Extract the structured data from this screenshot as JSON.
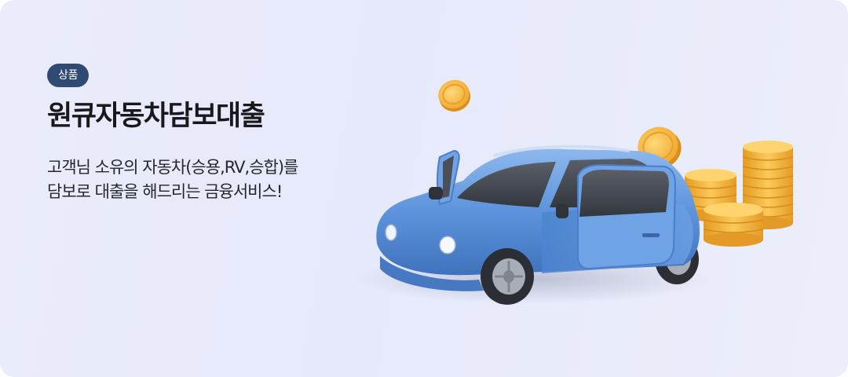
{
  "banner": {
    "badge": "상품",
    "title": "원큐자동차담보대출",
    "description_lines": [
      "고객님 소유의 자동차(승용,RV,승합)를",
      "담보로 대출을 해드리는 금융서비스!"
    ]
  },
  "illustration": {
    "subject": "car-with-coins",
    "car_color": "#5c93dc",
    "coin_color": "#f5b53a"
  }
}
